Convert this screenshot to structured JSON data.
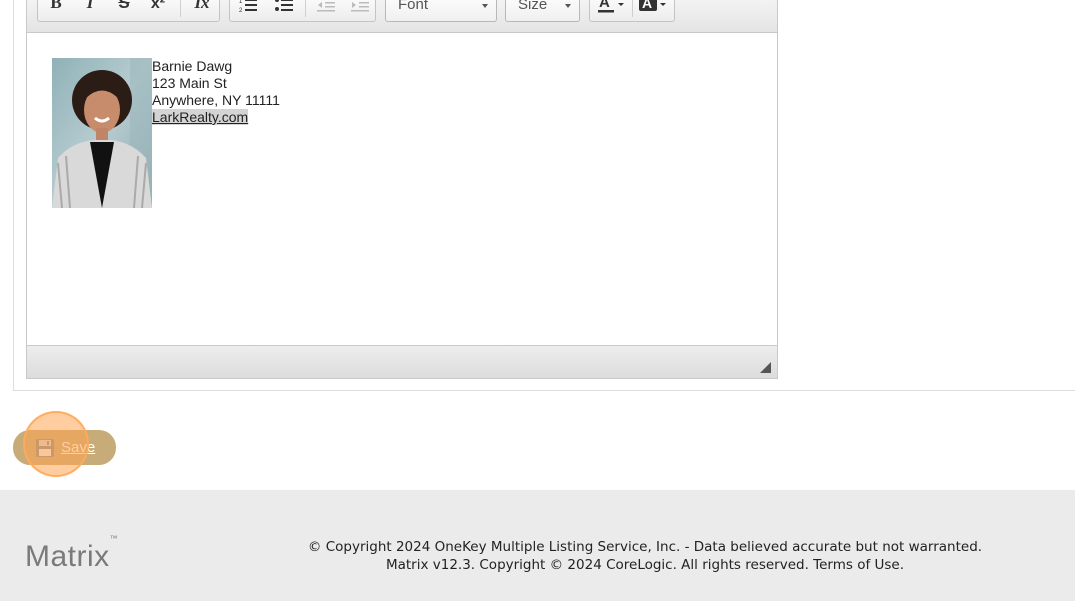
{
  "toolbar": {
    "font_combo": "Font",
    "size_combo": "Size",
    "bold": "B",
    "italic": "I",
    "strike": "S",
    "superscript": "x²",
    "remove_format": "Ix"
  },
  "signature": {
    "name": "Barnie Dawg",
    "street": "123 Main St",
    "city": "Anywhere, NY 11111",
    "website": "LarkRealty.com"
  },
  "actions": {
    "save_label": "Save"
  },
  "footer": {
    "logo_text": "Matrix",
    "logo_tm": "™",
    "copyright_line1": "© Copyright 2024 OneKey Multiple Listing Service, Inc. - Data believed accurate but not warranted.",
    "copyright_line2_prefix": "Matrix v12.3. Copyright © 2024 CoreLogic. All rights reserved.",
    "terms_link": "Terms of Use."
  },
  "colors": {
    "save_button_bg": "#c7ac7a",
    "click_highlight": "#ffa450",
    "footer_bg": "#ebebeb"
  }
}
